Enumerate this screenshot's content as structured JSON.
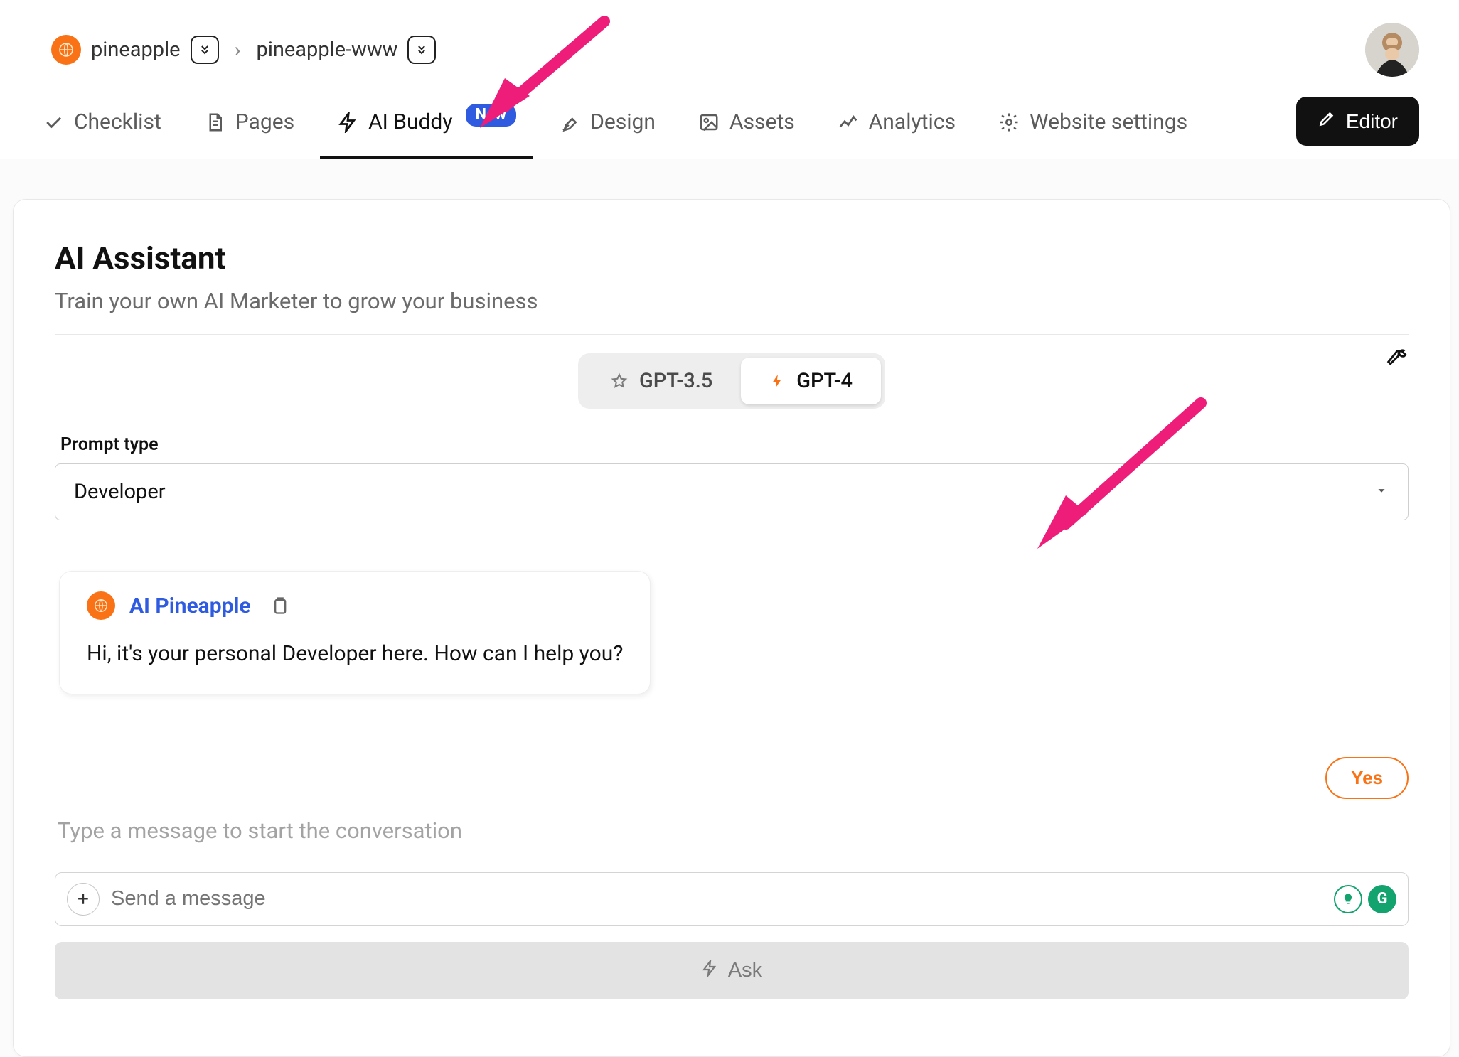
{
  "breadcrumb": {
    "site_name": "pineapple",
    "page_name": "pineapple-www"
  },
  "nav": {
    "checklist": "Checklist",
    "pages": "Pages",
    "ai_buddy": "AI Buddy",
    "new_badge": "New",
    "design": "Design",
    "assets": "Assets",
    "analytics": "Analytics",
    "website_settings": "Website settings",
    "editor_button": "Editor",
    "active_tab": "ai_buddy"
  },
  "assistant": {
    "title": "AI Assistant",
    "subtitle": "Train your own AI Marketer to grow your business",
    "models": {
      "gpt35": "GPT-3.5",
      "gpt4": "GPT-4",
      "selected": "gpt4"
    },
    "prompt_type_label": "Prompt type",
    "prompt_type_value": "Developer",
    "settings_icon": "wrench-icon"
  },
  "chat": {
    "bot_name": "AI Pineapple",
    "greeting": "Hi, it's your personal Developer here. How can I help you?",
    "yes_button": "Yes",
    "hint": "Type a message to start the conversation",
    "input_placeholder": "Send a message",
    "ask_button": "Ask"
  },
  "colors": {
    "brand_orange": "#f97316",
    "accent_blue": "#2e5bdf",
    "annotation_pink": "#ed1d79",
    "grammarly_green": "#12a36f"
  }
}
